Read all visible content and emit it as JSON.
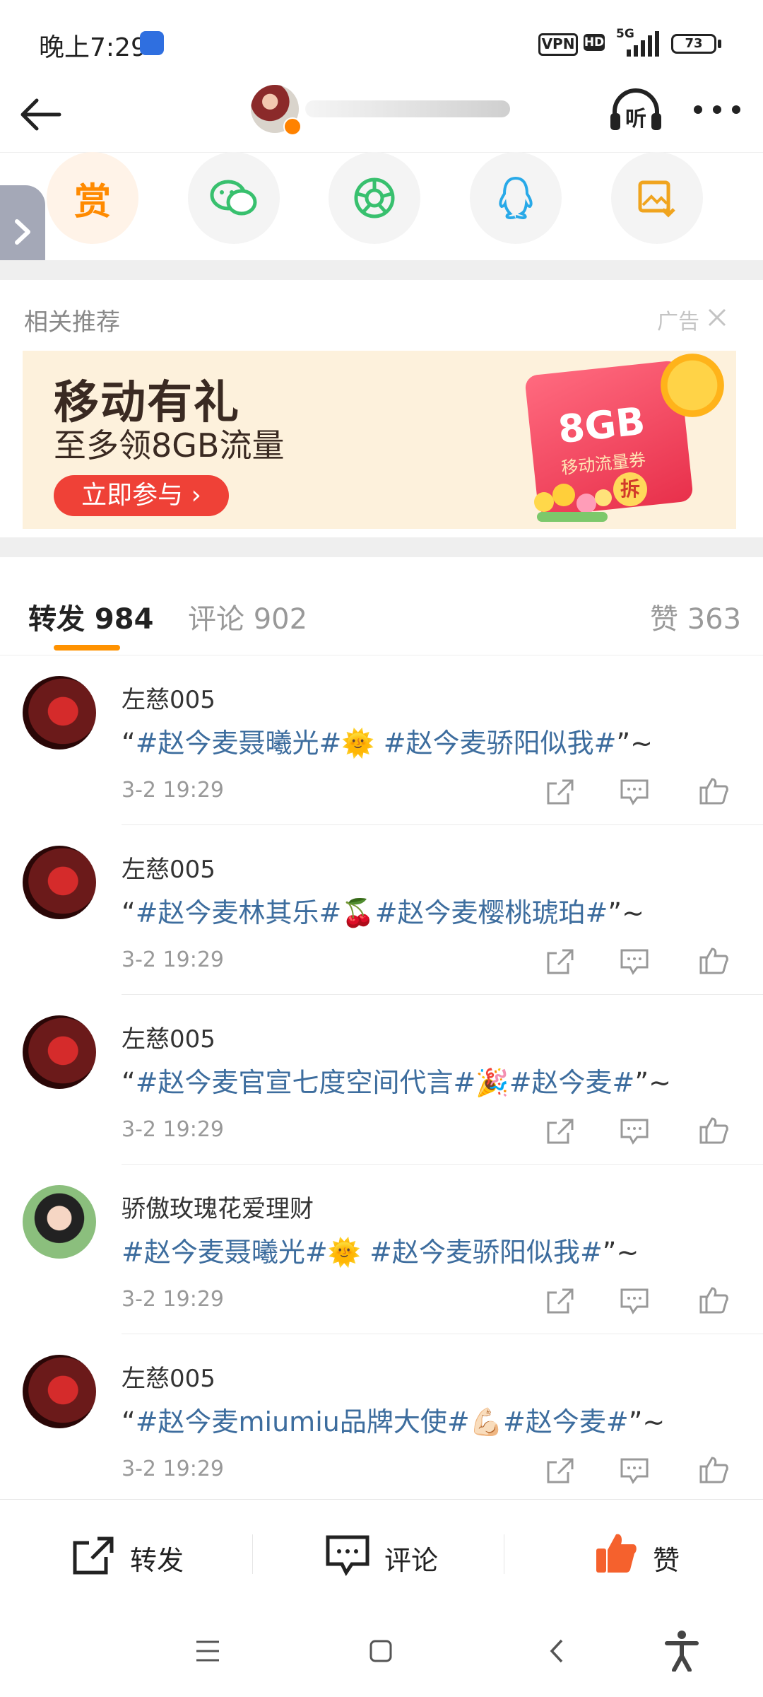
{
  "status_bar": {
    "time": "晚上7:29",
    "vpn": "VPN",
    "hd": "HD",
    "network": "5G",
    "battery": "73"
  },
  "header": {
    "listen_label": "听"
  },
  "recommend": {
    "title": "相关推荐",
    "ad_label": "广告"
  },
  "ad": {
    "title": "移动有礼",
    "subtitle": "至多领8GB流量",
    "cta": "立即参与 ›",
    "card_amount": "8GB",
    "card_text": "移动流量券",
    "card_badge": "拆"
  },
  "tabs": {
    "repost": "转发 984",
    "comment": "评论 902",
    "like": "赞 363"
  },
  "reposts": [
    {
      "user": "左慈005",
      "time": "3-2 19:29"
    },
    {
      "user": "左慈005",
      "time": "3-2 19:29"
    },
    {
      "user": "左慈005",
      "time": "3-2 19:29"
    },
    {
      "user": "骄傲玫瑰花爱理财",
      "time": "3-2 19:29"
    },
    {
      "user": "左慈005",
      "time": "3-2 19:29"
    }
  ],
  "texts": {
    "r0": {
      "open": "“",
      "t1": "#赵今麦聂曦光#",
      "emoji": "🌞",
      "sp": " ",
      "t2": "#赵今麦骄阳似我#",
      "close": "”~"
    },
    "r1": {
      "open": "“",
      "t1": "#赵今麦林其乐#",
      "emoji": "🍒",
      "sp": "",
      "t2": "#赵今麦樱桃琥珀#",
      "close": "”~"
    },
    "r2": {
      "open": "“",
      "t1": "#赵今麦官宣七度空间代言#",
      "emoji": "🎉",
      "sp": "",
      "t2": "#赵今麦#",
      "close": "”~"
    },
    "r3": {
      "open": "",
      "t1": "#赵今麦聂曦光#",
      "emoji": "🌞",
      "sp": " ",
      "t2": "#赵今麦骄阳似我#",
      "close": "”~"
    },
    "r4": {
      "open": "“",
      "t1": "#赵今麦miumiu品牌大使#",
      "emoji": "💪🏻",
      "sp": "",
      "t2": "#赵今麦#",
      "close": "”~"
    }
  },
  "bottom_bar": {
    "repost": "转发",
    "comment": "评论",
    "like": "赞"
  },
  "colors": {
    "accent": "#ff9200",
    "topic": "#3d6d9e",
    "like_icon": "#f5612d"
  }
}
